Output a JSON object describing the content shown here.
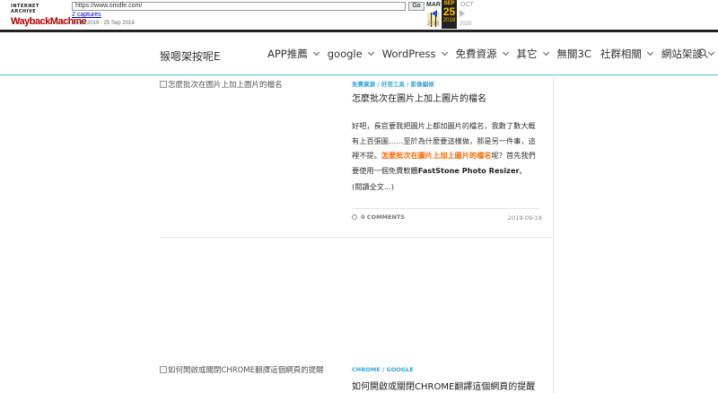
{
  "wayback": {
    "logo_top": "INTERNET ARCHIVE",
    "logo_main": "WaybackMachine",
    "url": "https://www.omdfe.com/",
    "go_label": "Go",
    "captures": "2 captures",
    "range": "2 Mar 2019 - 25 Sep 2019",
    "prev_month": "MAR",
    "cur_month": "SEP",
    "cur_day": "25",
    "next_month": "OCT",
    "prev_year": "2018",
    "cur_year": "2019",
    "next_year": "2020"
  },
  "header": {
    "site_title": "猴嗯架按呢E",
    "nav": [
      {
        "label": "APP推薦",
        "has_menu": true
      },
      {
        "label": "google",
        "has_menu": true
      },
      {
        "label": "WordPress",
        "has_menu": true
      },
      {
        "label": "免費資源",
        "has_menu": true
      },
      {
        "label": "其它",
        "has_menu": true
      },
      {
        "label": "無關3C",
        "has_menu": false
      },
      {
        "label": "社群相關",
        "has_menu": true
      },
      {
        "label": "網站架設",
        "has_menu": true
      }
    ]
  },
  "posts": [
    {
      "thumb_alt": "怎麼批次在圖片上加上圖片的檔名",
      "categories": "免費資源 / 好用工具 / 影像編修",
      "title": "怎麼批次在圖片上加上圖片的檔名",
      "excerpt_a": "好吧，長官要我把圖片上都加圖片的檔名，我數了數大概有上百張圖……至於為什麼要這樣做，那是另一件事，這裡不提。",
      "excerpt_hl": "怎麼批次在圖片上加上圖片的檔名",
      "excerpt_b": "呢？首先我們要使用一個免費軟體",
      "excerpt_bold": "FastStone Photo Resizer",
      "excerpt_c": "。",
      "read_more": "(閱讀全文...)",
      "comments": "0 COMMENTS",
      "date": "2019-09-19"
    },
    {
      "thumb_alt": "如何開啟或關閉CHROME翻譯這個網頁的提醒",
      "categories": "CHROME / GOOGLE",
      "title": "如何開啟或關閉CHROME翻譯這個網頁的提醒"
    }
  ],
  "colors": {
    "accent": "#3aa7d6",
    "highlight": "#ff6a00",
    "header_line": "#4fc3e0"
  }
}
